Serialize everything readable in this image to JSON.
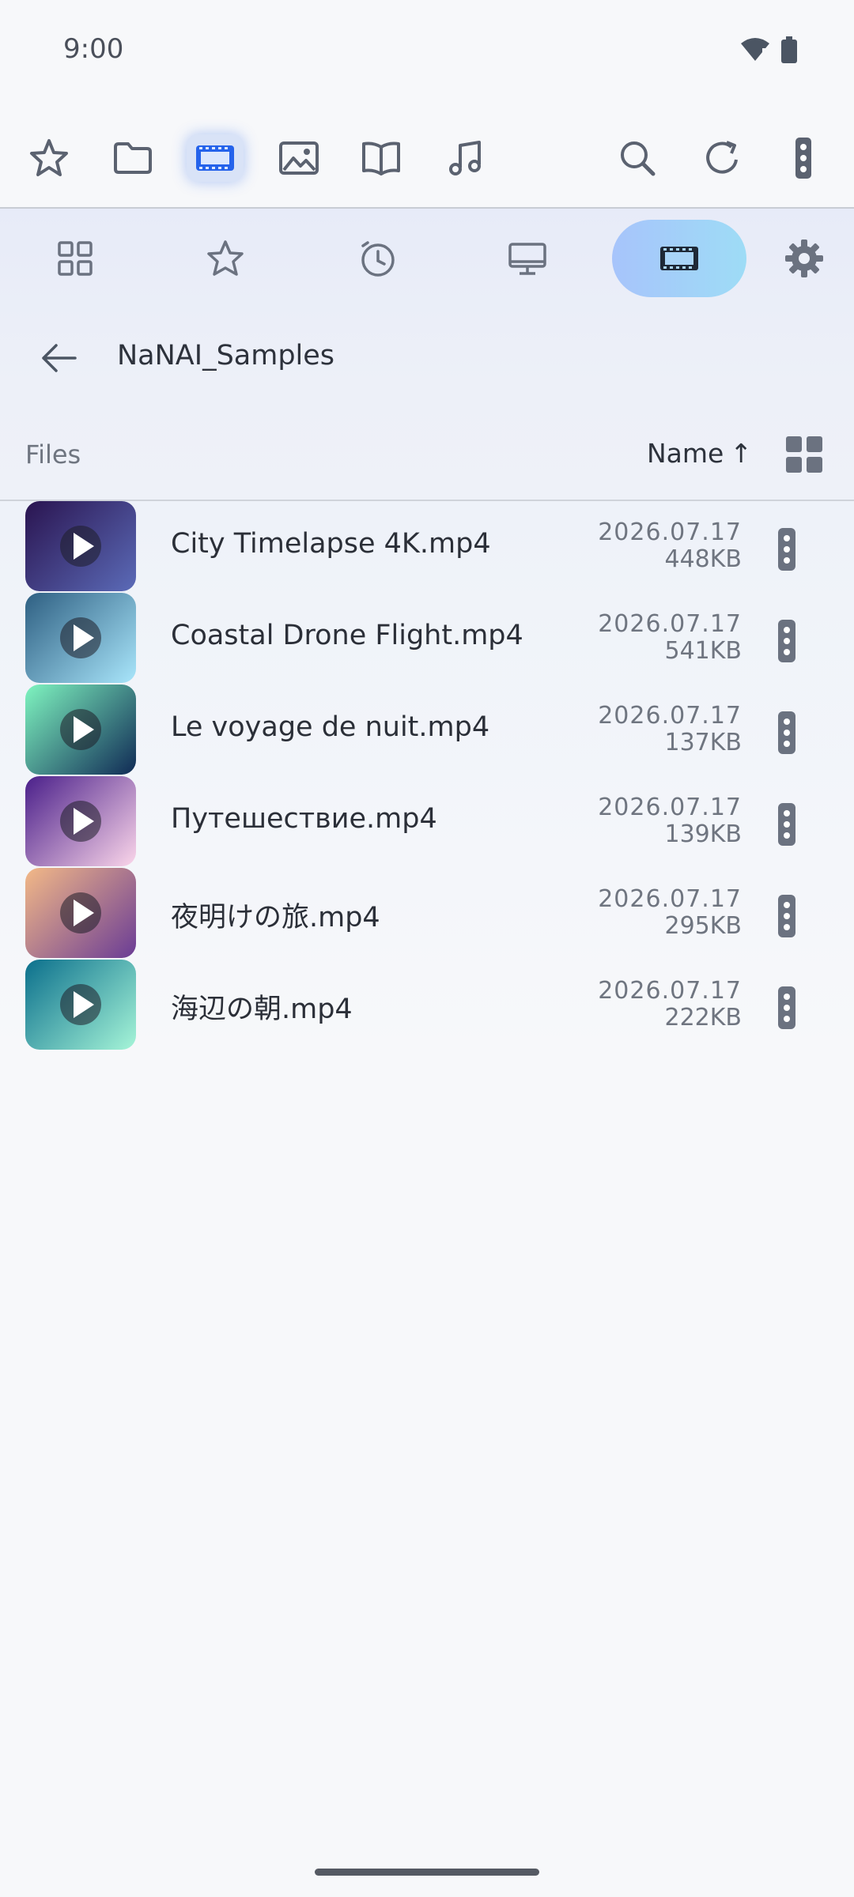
{
  "status_bar": {
    "time": "9:00"
  },
  "toolbar": {
    "items": [
      {
        "icon": "star-icon"
      },
      {
        "icon": "folder-icon"
      },
      {
        "icon": "film-icon",
        "active": true
      },
      {
        "icon": "image-icon"
      },
      {
        "icon": "book-icon"
      },
      {
        "icon": "music-note-icon"
      },
      {
        "icon": "search-icon"
      },
      {
        "icon": "refresh-icon"
      },
      {
        "icon": "more-vertical-icon"
      }
    ],
    "active_color": "#2563eb"
  },
  "nav": {
    "items": [
      {
        "icon": "grid-icon"
      },
      {
        "icon": "star-icon"
      },
      {
        "icon": "history-clock-icon"
      },
      {
        "icon": "monitor-icon"
      },
      {
        "icon": "film-icon",
        "active": true
      },
      {
        "icon": "gear-icon"
      }
    ]
  },
  "folder": {
    "title": "NaNAI_Samples"
  },
  "list_header": {
    "label": "Files",
    "sort_label": "Name",
    "sort_arrow": "↑"
  },
  "files": [
    {
      "name": "City Timelapse 4K.mp4",
      "date": "2026.07.17",
      "size": "448KB",
      "thumb_colors": [
        "#2a1450",
        "#5b6bb8"
      ]
    },
    {
      "name": "Coastal Drone Flight.mp4",
      "date": "2026.07.17",
      "size": "541KB",
      "thumb_colors": [
        "#2e5f82",
        "#a9e6fb"
      ]
    },
    {
      "name": "Le voyage de nuit.mp4",
      "date": "2026.07.17",
      "size": "137KB",
      "thumb_colors": [
        "#7ff5c0",
        "#102a55"
      ]
    },
    {
      "name": "Путешествие.mp4",
      "date": "2026.07.17",
      "size": "139KB",
      "thumb_colors": [
        "#4a1f8a",
        "#fbd6ea"
      ]
    },
    {
      "name": "夜明けの旅.mp4",
      "date": "2026.07.17",
      "size": "295KB",
      "thumb_colors": [
        "#f3b987",
        "#6a3c95"
      ]
    },
    {
      "name": "海辺の朝.mp4",
      "date": "2026.07.17",
      "size": "222KB",
      "thumb_colors": [
        "#0b6f8c",
        "#a6f5d8"
      ]
    }
  ]
}
